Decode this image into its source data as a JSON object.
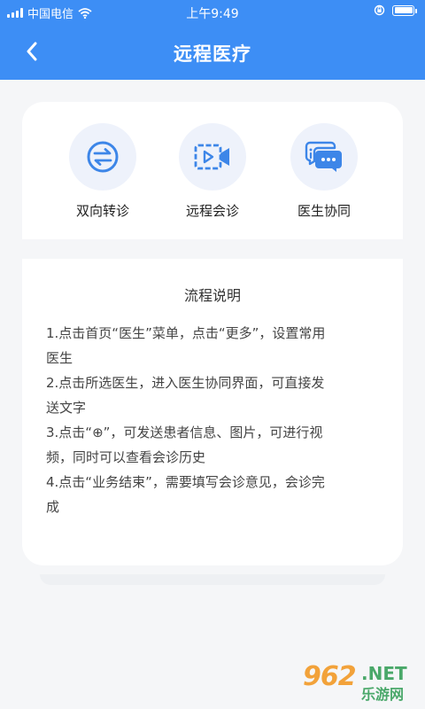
{
  "status_bar": {
    "carrier": "中国电信",
    "time": "上午9:49"
  },
  "nav": {
    "back_icon": "chevron-left-icon",
    "title": "远程医疗"
  },
  "functions": [
    {
      "label": "双向转诊",
      "icon": "transfer-arrows-icon"
    },
    {
      "label": "远程会诊",
      "icon": "video-consult-icon"
    },
    {
      "label": "医生协同",
      "icon": "chat-bubbles-icon"
    }
  ],
  "instructions": {
    "title": "流程说明",
    "lines": [
      "1.点击首页“医生”菜单，点击“更多”，设置常用",
      "医生",
      "2.点击所选医生，进入医生协同界面，可直接发",
      "送文字",
      "3.点击“⊕”，可发送患者信息、图片，可进行视",
      "频，同时可以查看会诊历史",
      "4.点击“业务结束”，需要填写会诊意见，会诊完",
      "成"
    ]
  },
  "watermark": {
    "number": "962",
    "suffix": ".NET",
    "sub": "乐游网"
  },
  "colors": {
    "header": "#3d8ef5",
    "accent": "#3d86e8",
    "background": "#f5f6f8"
  }
}
